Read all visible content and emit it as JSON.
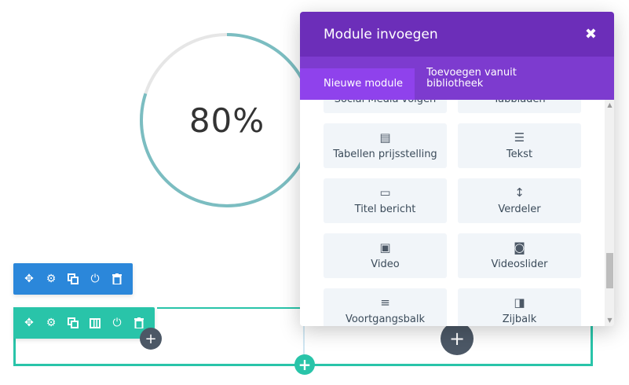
{
  "counter": {
    "value": "80%",
    "percent": 0.8,
    "track_color": "#e6e6e6",
    "bar_color": "#7bbdc1"
  },
  "toolbar_blue": {
    "icons": [
      "move-icon",
      "gear-icon",
      "duplicate-icon",
      "power-icon",
      "trash-icon"
    ],
    "color": "#2b87da"
  },
  "toolbar_green": {
    "icons": [
      "move-icon",
      "gear-icon",
      "duplicate-icon",
      "columns-icon",
      "power-icon",
      "trash-icon"
    ],
    "color": "#29c4a9"
  },
  "modal": {
    "title": "Module invoegen",
    "close": "✖",
    "tabs": [
      {
        "label": "Nieuwe module",
        "active": true
      },
      {
        "label": "Toevoegen vanuit bibliotheek",
        "active": false
      }
    ],
    "modules": [
      {
        "label": "Social Media volgen",
        "icon": "share-icon"
      },
      {
        "label": "Tabbladen",
        "icon": "tabs-icon"
      },
      {
        "label": "Tabellen prijsstelling",
        "icon": "pricing-table-icon"
      },
      {
        "label": "Tekst",
        "icon": "text-icon"
      },
      {
        "label": "Titel bericht",
        "icon": "post-title-icon"
      },
      {
        "label": "Verdeler",
        "icon": "divider-icon"
      },
      {
        "label": "Video",
        "icon": "video-icon"
      },
      {
        "label": "Videoslider",
        "icon": "video-slider-icon"
      },
      {
        "label": "Voortgangsbalk",
        "icon": "progress-bar-icon"
      },
      {
        "label": "Zijbalk",
        "icon": "sidebar-icon"
      }
    ],
    "colors": {
      "header": "#6c2eb9",
      "tabs": "#7d3bcf",
      "active_tab": "#8f42ec"
    }
  }
}
